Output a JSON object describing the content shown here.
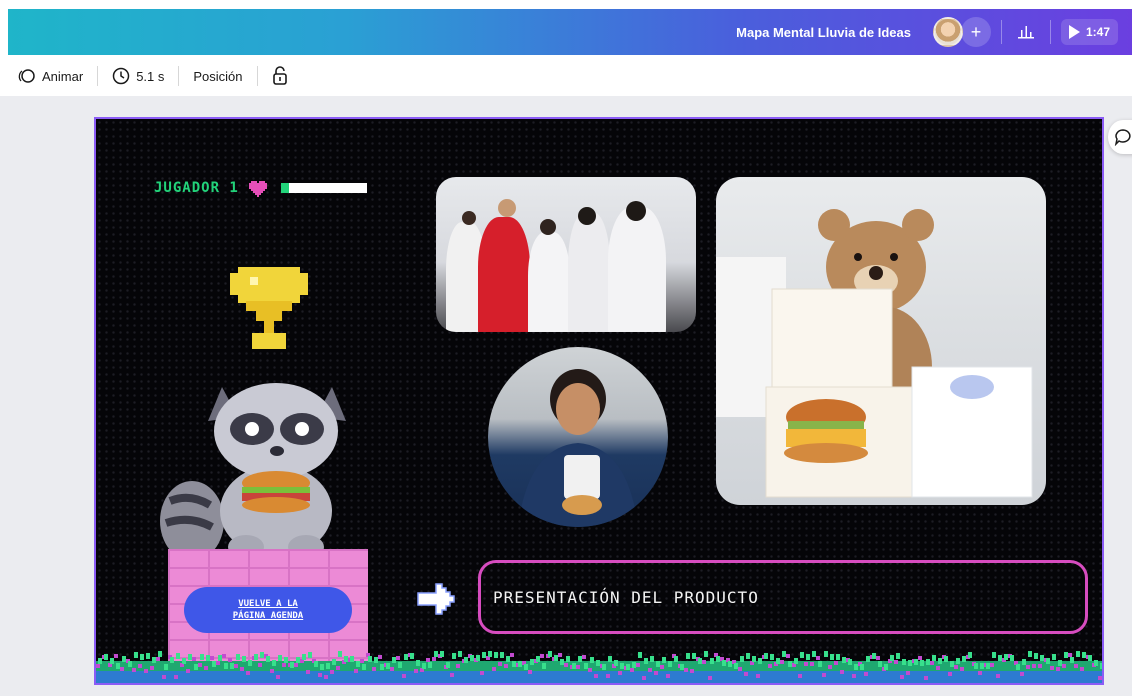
{
  "header": {
    "doc_title": "Mapa Mental Lluvia de Ideas",
    "plus_symbol": "+",
    "play_time": "1:47"
  },
  "toolbar": {
    "animate_label": "Animar",
    "duration_label": "5.1 s",
    "position_label": "Posición"
  },
  "slide": {
    "player_label": "JUGADOR 1",
    "back_button_line1": "VUELVE A LA",
    "back_button_line2": "PÁGINA AGENDA",
    "title": "PRESENTACIÓN DEL PRODUCTO"
  },
  "colors": {
    "accent_green": "#22d37a",
    "accent_pink": "#d64cbf",
    "button_blue": "#3f57e8",
    "selection_purple": "#8b5cf6"
  },
  "icons": {
    "animate": "animate-icon",
    "clock": "clock-icon",
    "lock": "lock-icon",
    "chart": "chart-icon",
    "play": "play-icon",
    "comment": "comment-icon"
  }
}
